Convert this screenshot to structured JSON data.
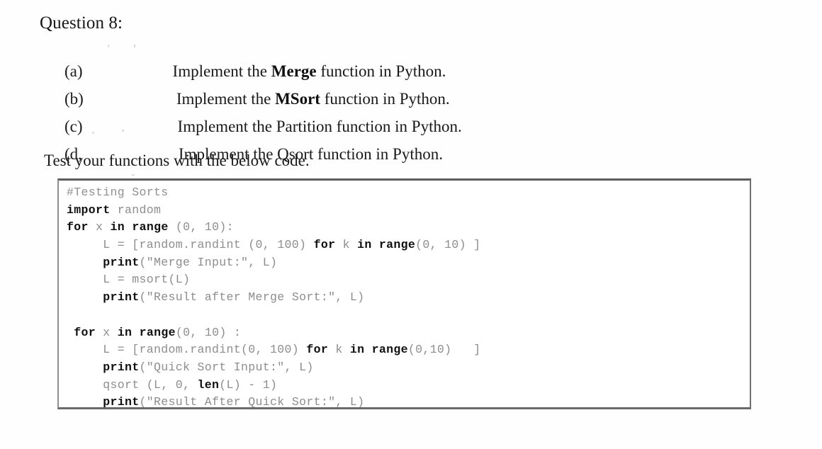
{
  "document": {
    "heading": "Question 8:",
    "items": [
      {
        "label": "(a)",
        "text_html": "Implement the <b>Merge</b> function in Python."
      },
      {
        "label": "(b)",
        "text_html": "Implement the <b>MSort</b> function in Python."
      },
      {
        "label": "(c)",
        "text_html": "Implement the Partition function in Python."
      },
      {
        "label": "(d,",
        "text_html": "Implement the Qsort function in Python."
      }
    ],
    "instruction": "Test your functions with the below code."
  },
  "code_block": {
    "language": "python",
    "lines": [
      {
        "html": "<span class=\"cmt\">#Testing Sorts</span>"
      },
      {
        "html": "<b>import</b> random"
      },
      {
        "html": "<b>for</b> x <b>in</b> <b>range</b> (0, 10):"
      },
      {
        "html": "     L = [random.randint (0, 100) <b>for</b> k <b>in</b> <b>range</b>(0, 10) ]"
      },
      {
        "html": "     <b>print</b>(\"Merge Input:\", L)"
      },
      {
        "html": "     L = msort(L)"
      },
      {
        "html": "     <b>print</b>(\"Result after Merge Sort:\", L)"
      },
      {
        "html": ""
      },
      {
        "html": " <b>for</b> x <b>in</b> <b>range</b>(0, 10) :"
      },
      {
        "html": "     L = [random.randint(0, 100) <b>for</b> k <b>in</b> <b>range</b>(0,10)   ]"
      },
      {
        "html": "     <b>print</b>(\"Quick Sort Input:\", L)"
      },
      {
        "html": "     qsort (L, 0, <b>len</b>(L) - 1)"
      },
      {
        "html": "     <b>print</b>(\"Result After Quick Sort:\", L)"
      }
    ]
  },
  "colors": {
    "page_background": "#fefefe",
    "text": "#191919",
    "code_text": "#8d8d8d",
    "code_keyword": "#101010",
    "code_border_top": "#5d5d5d",
    "code_border": "#8e8e8e"
  }
}
